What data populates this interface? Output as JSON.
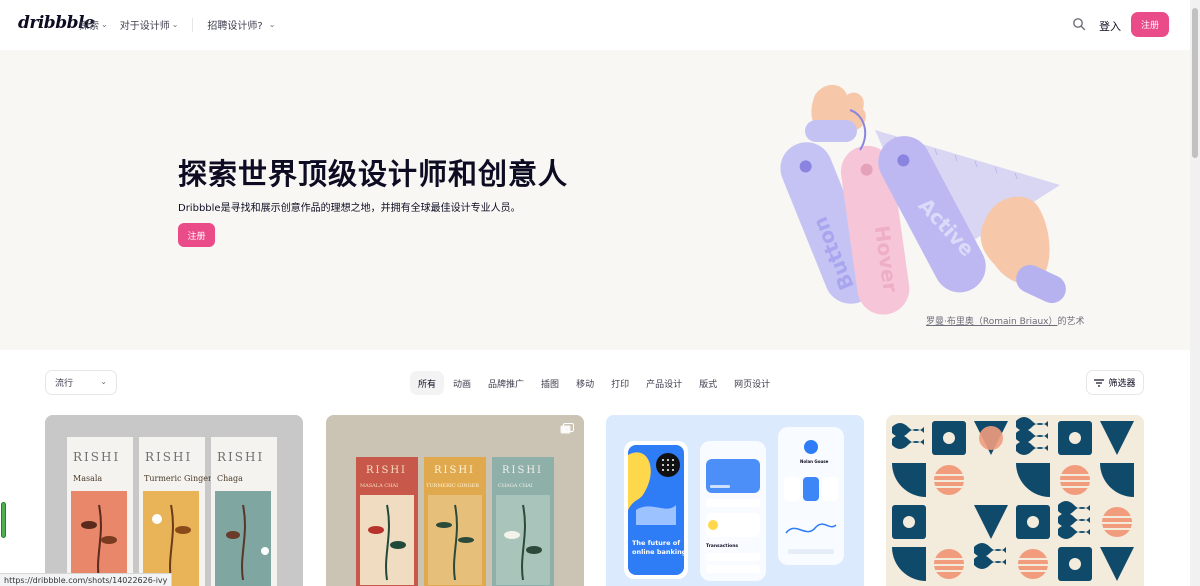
{
  "header": {
    "logo": "dribbble",
    "nav": [
      {
        "label": "探索",
        "chevron": "⌄"
      },
      {
        "label": "对于设计师",
        "chevron": "⌄"
      }
    ],
    "hire": {
      "label": "招聘设计师?",
      "chevron": "⌄"
    },
    "login_label": "登入",
    "signup_label": "注册"
  },
  "hero": {
    "title": "探索世界顶级设计师和创意人",
    "subtitle": "Dribbble是寻找和展示创意作品的理想之地，并拥有全球最佳设计专业人员。",
    "button_label": "注册",
    "art_tags": [
      "Button",
      "Hover",
      "Active"
    ],
    "credit_link": "罗曼·布里奥（Romain Briaux）",
    "credit_suffix": "的艺术"
  },
  "filters": {
    "sort": {
      "selected": "流行"
    },
    "categories": [
      {
        "label": "所有",
        "active": true
      },
      {
        "label": "动画",
        "active": false
      },
      {
        "label": "品牌推广",
        "active": false
      },
      {
        "label": "插图",
        "active": false
      },
      {
        "label": "移动",
        "active": false
      },
      {
        "label": "打印",
        "active": false
      },
      {
        "label": "产品设计",
        "active": false
      },
      {
        "label": "版式",
        "active": false
      },
      {
        "label": "网页设计",
        "active": false
      }
    ],
    "filter_label": "筛选器"
  },
  "shots": {
    "shot1": {
      "brand": "RISHI",
      "cartons": [
        "Masala",
        "Turmeric Ginger",
        "Chaga"
      ]
    },
    "shot2": {
      "brand": "RISHI",
      "cartons": [
        "MASALA CHAI",
        "TURMERIC GINGER",
        "CHAGA CHAI"
      ]
    },
    "shot3": {
      "headline_1": "The future of",
      "headline_2": "online banking.",
      "transactions": "Transactions",
      "profile": "Nolan Gouse"
    }
  },
  "status_bar": {
    "url": "https://dribbble.com/shots/14022626-ivy"
  },
  "colors": {
    "brand_pink": "#ea4c89",
    "text_dark": "#0d0c22",
    "hero_bg": "#f8f7f4"
  }
}
